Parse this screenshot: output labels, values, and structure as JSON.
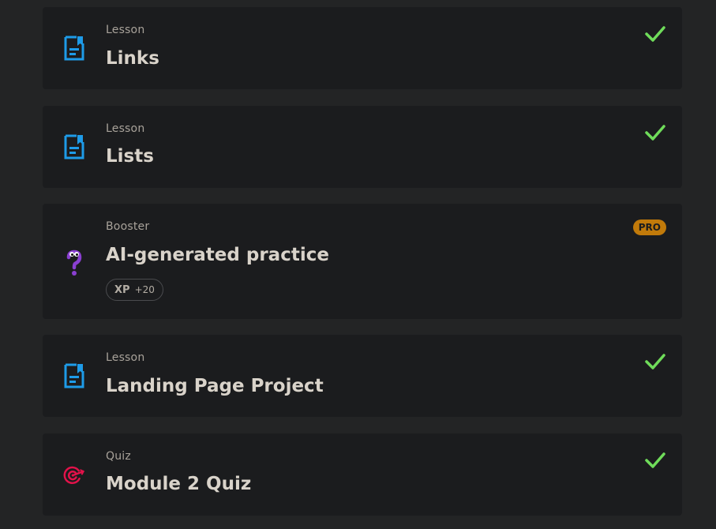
{
  "colors": {
    "page_bg": "#232425",
    "card_bg": "#1b1c1e",
    "lesson_icon": "#1e9be8",
    "check": "#6fdc5a",
    "booster_icon": "#8a3fd1",
    "quiz_icon": "#e2124a",
    "pro_badge": "#c17a0a"
  },
  "items": [
    {
      "type": "Lesson",
      "title": "Links",
      "icon": "lesson-document-icon",
      "completed": true
    },
    {
      "type": "Lesson",
      "title": "Lists",
      "icon": "lesson-document-icon",
      "completed": true
    },
    {
      "type": "Booster",
      "title": "AI-generated practice",
      "icon": "question-mark-icon",
      "badge": "PRO",
      "xp_label": "XP",
      "xp_value": "+20"
    },
    {
      "type": "Lesson",
      "title": "Landing Page Project",
      "icon": "lesson-document-icon",
      "completed": true
    },
    {
      "type": "Quiz",
      "title": "Module 2 Quiz",
      "icon": "target-icon",
      "completed": true
    }
  ]
}
